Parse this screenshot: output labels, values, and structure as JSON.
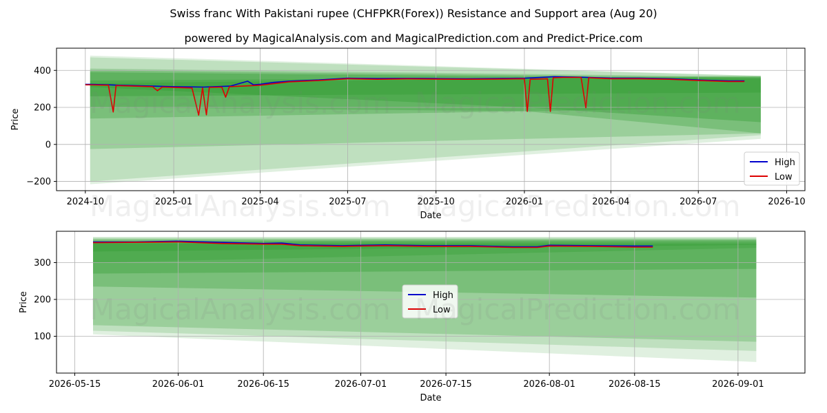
{
  "titles": {
    "main": "Swiss franc With Pakistani rupee (CHFPKR(Forex)) Resistance and Support area (Aug 20)",
    "sub": "powered by MagicalAnalysis.com and MagicalPrediction.com and Predict-Price.com"
  },
  "watermarks": [
    "MagicalAnalysis.com",
    "MagicalPrediction.com"
  ],
  "colors": {
    "high": "#0000cc",
    "low": "#dd0000",
    "band": "#2e9a2e"
  },
  "chart_data": [
    {
      "type": "line",
      "panel": "top",
      "xlabel": "Date",
      "ylabel": "Price",
      "ylim": [
        -250,
        520
      ],
      "yticks": [
        -200,
        0,
        200,
        400
      ],
      "ytick_labels": [
        "−200",
        "0",
        "200",
        "400"
      ],
      "xlim": [
        "2024-09-01",
        "2026-10-20"
      ],
      "xticks": [
        "2024-10",
        "2025-01",
        "2025-04",
        "2025-07",
        "2025-10",
        "2026-01",
        "2026-04",
        "2026-07",
        "2026-10"
      ],
      "xtick_dates": [
        "2024-10-01",
        "2025-01-01",
        "2025-04-01",
        "2025-07-01",
        "2025-10-01",
        "2026-01-01",
        "2026-04-01",
        "2026-07-01",
        "2026-10-01"
      ],
      "grid": true,
      "legend": "lower right",
      "series": [
        {
          "name": "High",
          "color": "#0000cc",
          "points": [
            [
              "2024-10-01",
              325
            ],
            [
              "2024-10-25",
              322
            ],
            [
              "2024-11-05",
              320
            ],
            [
              "2024-11-20",
              318
            ],
            [
              "2024-12-10",
              315
            ],
            [
              "2025-01-01",
              312
            ],
            [
              "2025-02-01",
              310
            ],
            [
              "2025-03-01",
              315
            ],
            [
              "2025-03-19",
              342
            ],
            [
              "2025-03-25",
              322
            ],
            [
              "2025-04-01",
              325
            ],
            [
              "2025-04-15",
              335
            ],
            [
              "2025-05-01",
              342
            ],
            [
              "2025-06-01",
              348
            ],
            [
              "2025-07-01",
              358
            ],
            [
              "2025-08-01",
              356
            ],
            [
              "2025-09-01",
              357
            ],
            [
              "2025-10-01",
              356
            ],
            [
              "2025-11-01",
              355
            ],
            [
              "2025-12-01",
              356
            ],
            [
              "2026-01-01",
              358
            ],
            [
              "2026-02-01",
              366
            ],
            [
              "2026-03-01",
              363
            ],
            [
              "2026-04-01",
              358
            ],
            [
              "2026-05-01",
              358
            ],
            [
              "2026-06-01",
              355
            ],
            [
              "2026-07-01",
              348
            ],
            [
              "2026-08-01",
              343
            ],
            [
              "2026-08-18",
              343
            ]
          ]
        },
        {
          "name": "Low",
          "color": "#dd0000",
          "points": [
            [
              "2024-10-01",
              322
            ],
            [
              "2024-10-25",
              320
            ],
            [
              "2024-10-30",
              175
            ],
            [
              "2024-11-02",
              318
            ],
            [
              "2024-11-20",
              315
            ],
            [
              "2024-12-10",
              312
            ],
            [
              "2024-12-15",
              290
            ],
            [
              "2024-12-20",
              310
            ],
            [
              "2025-01-01",
              308
            ],
            [
              "2025-01-20",
              305
            ],
            [
              "2025-01-27",
              158
            ],
            [
              "2025-01-31",
              305
            ],
            [
              "2025-02-04",
              160
            ],
            [
              "2025-02-07",
              308
            ],
            [
              "2025-02-20",
              310
            ],
            [
              "2025-02-24",
              255
            ],
            [
              "2025-02-28",
              312
            ],
            [
              "2025-03-25",
              318
            ],
            [
              "2025-04-01",
              320
            ],
            [
              "2025-05-01",
              338
            ],
            [
              "2025-06-01",
              345
            ],
            [
              "2025-07-01",
              355
            ],
            [
              "2025-08-01",
              352
            ],
            [
              "2025-09-01",
              354
            ],
            [
              "2025-10-01",
              353
            ],
            [
              "2025-11-01",
              352
            ],
            [
              "2025-12-01",
              353
            ],
            [
              "2026-01-01",
              355
            ],
            [
              "2026-01-04",
              178
            ],
            [
              "2026-01-07",
              352
            ],
            [
              "2026-01-25",
              355
            ],
            [
              "2026-01-28",
              178
            ],
            [
              "2026-01-31",
              360
            ],
            [
              "2026-02-10",
              362
            ],
            [
              "2026-03-01",
              362
            ],
            [
              "2026-03-06",
              198
            ],
            [
              "2026-03-09",
              360
            ],
            [
              "2026-04-01",
              355
            ],
            [
              "2026-05-01",
              355
            ],
            [
              "2026-06-01",
              352
            ],
            [
              "2026-07-01",
              345
            ],
            [
              "2026-08-01",
              340
            ],
            [
              "2026-08-18",
              340
            ]
          ]
        }
      ],
      "bands": [
        {
          "x": [
            "2024-10-06",
            "2026-09-04"
          ],
          "y0": [
            480,
            370
          ],
          "y1": [
            -215,
            30
          ],
          "opacity": 0.15
        },
        {
          "x": [
            "2024-10-06",
            "2026-09-04"
          ],
          "y0": [
            470,
            370
          ],
          "y1": [
            -200,
            50
          ],
          "opacity": 0.18
        },
        {
          "x": [
            "2024-10-06",
            "2026-09-04"
          ],
          "y0": [
            410,
            365
          ],
          "y1": [
            -25,
            60
          ],
          "opacity": 0.25
        },
        {
          "x": [
            "2024-10-06",
            "2026-09-04"
          ],
          "y0": [
            400,
            360
          ],
          "y1": [
            140,
            200
          ],
          "opacity": 0.3
        },
        {
          "x": [
            "2024-10-06",
            "2026-09-04"
          ],
          "y0": [
            390,
            355
          ],
          "y1": [
            260,
            280
          ],
          "opacity": 0.35
        },
        {
          "x": [
            "2024-10-06",
            "2026-01-01",
            "2026-09-04"
          ],
          "y0": [
            345,
            360,
            370
          ],
          "y1": [
            200,
            180,
            60
          ],
          "opacity": 0.3
        },
        {
          "x": [
            "2024-10-06",
            "2026-01-01",
            "2026-09-04"
          ],
          "y0": [
            330,
            355,
            365
          ],
          "y1": [
            310,
            200,
            120
          ],
          "opacity": 0.35
        }
      ]
    },
    {
      "type": "line",
      "panel": "bottom",
      "xlabel": "Date",
      "ylabel": "Price",
      "ylim": [
        0,
        385
      ],
      "yticks": [
        100,
        200,
        300
      ],
      "ytick_labels": [
        "100",
        "200",
        "300"
      ],
      "xlim": [
        "2026-05-12",
        "2026-09-12"
      ],
      "xticks": [
        "2026-05-15",
        "2026-06-01",
        "2026-06-15",
        "2026-07-01",
        "2026-07-15",
        "2026-08-01",
        "2026-08-15",
        "2026-09-01"
      ],
      "xtick_dates": [
        "2026-05-15",
        "2026-06-01",
        "2026-06-15",
        "2026-07-01",
        "2026-07-15",
        "2026-08-01",
        "2026-08-15",
        "2026-09-01"
      ],
      "grid": true,
      "legend": "center",
      "series": [
        {
          "name": "High",
          "color": "#0000cc",
          "points": [
            [
              "2026-05-18",
              356
            ],
            [
              "2026-05-25",
              356
            ],
            [
              "2026-06-01",
              358
            ],
            [
              "2026-06-08",
              355
            ],
            [
              "2026-06-15",
              352
            ],
            [
              "2026-06-18",
              353
            ],
            [
              "2026-06-21",
              348
            ],
            [
              "2026-06-28",
              346
            ],
            [
              "2026-07-05",
              348
            ],
            [
              "2026-07-12",
              346
            ],
            [
              "2026-07-19",
              346
            ],
            [
              "2026-07-26",
              343
            ],
            [
              "2026-07-30",
              343
            ],
            [
              "2026-08-01",
              347
            ],
            [
              "2026-08-08",
              346
            ],
            [
              "2026-08-15",
              345
            ],
            [
              "2026-08-18",
              345
            ]
          ]
        },
        {
          "name": "Low",
          "color": "#dd0000",
          "points": [
            [
              "2026-05-18",
              354
            ],
            [
              "2026-05-25",
              355
            ],
            [
              "2026-06-01",
              356
            ],
            [
              "2026-06-08",
              352
            ],
            [
              "2026-06-15",
              350
            ],
            [
              "2026-06-18",
              350
            ],
            [
              "2026-06-21",
              346
            ],
            [
              "2026-06-28",
              344
            ],
            [
              "2026-07-05",
              346
            ],
            [
              "2026-07-12",
              344
            ],
            [
              "2026-07-19",
              344
            ],
            [
              "2026-07-26",
              341
            ],
            [
              "2026-07-30",
              341
            ],
            [
              "2026-08-01",
              345
            ],
            [
              "2026-08-08",
              344
            ],
            [
              "2026-08-15",
              342
            ],
            [
              "2026-08-18",
              342
            ]
          ]
        }
      ],
      "bands": [
        {
          "x": [
            "2026-05-18",
            "2026-09-04"
          ],
          "y0": [
            370,
            370
          ],
          "y1": [
            105,
            30
          ],
          "opacity": 0.15
        },
        {
          "x": [
            "2026-05-18",
            "2026-09-04"
          ],
          "y0": [
            368,
            368
          ],
          "y1": [
            115,
            60
          ],
          "opacity": 0.18
        },
        {
          "x": [
            "2026-05-18",
            "2026-09-04"
          ],
          "y0": [
            365,
            365
          ],
          "y1": [
            130,
            85
          ],
          "opacity": 0.25
        },
        {
          "x": [
            "2026-05-18",
            "2026-09-04"
          ],
          "y0": [
            362,
            362
          ],
          "y1": [
            235,
            205
          ],
          "opacity": 0.3
        },
        {
          "x": [
            "2026-05-18",
            "2026-09-04"
          ],
          "y0": [
            358,
            360
          ],
          "y1": [
            270,
            283
          ],
          "opacity": 0.35
        },
        {
          "x": [
            "2026-05-18",
            "2026-09-04"
          ],
          "y0": [
            355,
            355
          ],
          "y1": [
            300,
            340
          ],
          "opacity": 0.3
        },
        {
          "x": [
            "2026-05-18",
            "2026-09-04"
          ],
          "y0": [
            352,
            350
          ],
          "y1": [
            330,
            348
          ],
          "opacity": 0.35
        }
      ]
    }
  ]
}
